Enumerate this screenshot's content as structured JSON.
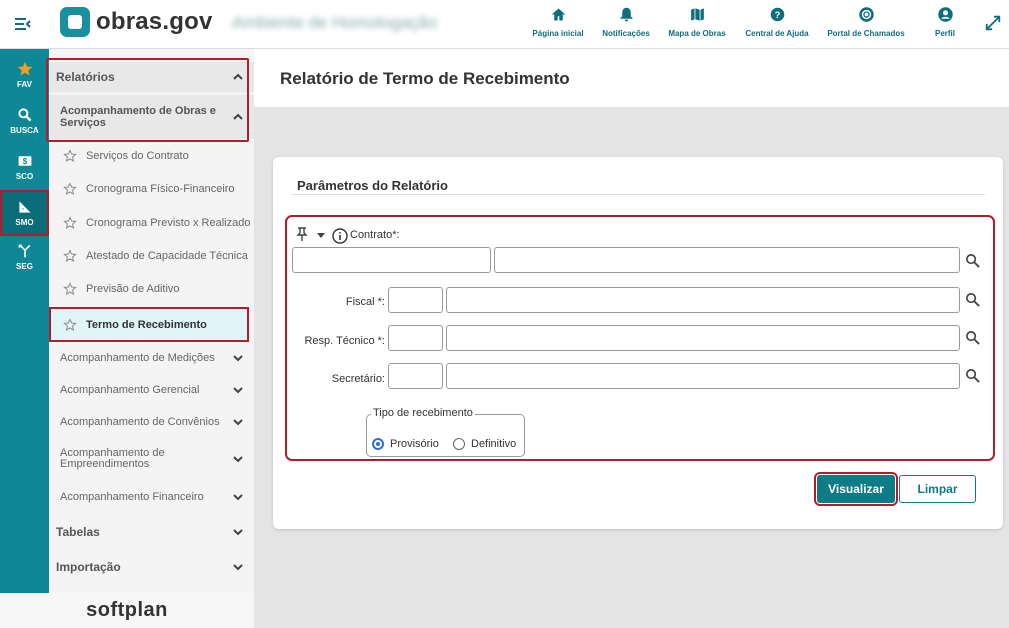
{
  "header": {
    "brand": "obras.gov",
    "environment": "Ambiente de Homologação",
    "nav": [
      {
        "label": "Página inicial",
        "icon": "home-icon"
      },
      {
        "label": "Notificações",
        "icon": "bell-icon"
      },
      {
        "label": "Mapa de Obras",
        "icon": "map-icon"
      },
      {
        "label": "Central de Ajuda",
        "icon": "help-icon"
      },
      {
        "label": "Portal de Chamados",
        "icon": "lifebuoy-icon"
      },
      {
        "label": "Perfil",
        "icon": "user-icon"
      }
    ]
  },
  "rail": {
    "items": [
      {
        "label": "FAV",
        "icon": "star-icon"
      },
      {
        "label": "BUSCA",
        "icon": "search-icon"
      },
      {
        "label": "SCO",
        "icon": "money-icon"
      },
      {
        "label": "SMO",
        "icon": "ruler-icon"
      },
      {
        "label": "SEG",
        "icon": "merge-icon"
      }
    ]
  },
  "menu": {
    "section_relatorios": "Relatórios",
    "group_acompanhamento": "Acompanhamento de Obras e Serviços",
    "items": [
      "Serviços do Contrato",
      "Cronograma Físico-Financeiro",
      "Cronograma Previsto x Realizado",
      "Atestado de Capacidade Técnica",
      "Previsão de Aditivo",
      "Termo de Recebimento"
    ],
    "subgroups": [
      "Acompanhamento de Medições",
      "Acompanhamento Gerencial",
      "Acompanhamento de Convênios",
      "Acompanhamento de Empreendimentos",
      "Acompanhamento Financeiro"
    ],
    "section_tabelas": "Tabelas",
    "section_importacao": "Importação",
    "footer_brand": "softplan"
  },
  "page": {
    "title": "Relatório de Termo de Recebimento",
    "card_title": "Parâmetros do Relatório",
    "fields": {
      "contrato_label": "Contrato*:",
      "fiscal_label": "Fiscal *:",
      "resp_label": "Resp. Técnico *:",
      "secretario_label": "Secretário:"
    },
    "tipo": {
      "legend": "Tipo de recebimento",
      "options": [
        "Provisório",
        "Definitivo"
      ],
      "selected": "Provisório"
    },
    "buttons": {
      "visualizar": "Visualizar",
      "limpar": "Limpar"
    }
  },
  "colors": {
    "accent": "#0e8896",
    "highlight_border": "#b21c2b",
    "primary_button": "#0e7c86"
  }
}
